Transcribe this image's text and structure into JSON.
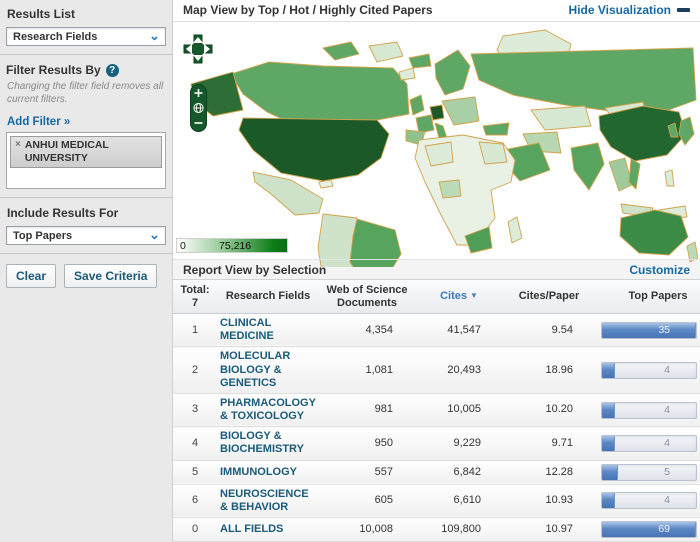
{
  "sidebar": {
    "results_list_label": "Results List",
    "results_list_value": "Research Fields",
    "filter_by_label": "Filter Results By",
    "help_icon_glyph": "?",
    "filter_note": "Changing the filter field removes all current filters.",
    "add_filter_label": "Add Filter »",
    "filter_tags": [
      {
        "remove_glyph": "×",
        "label": "ANHUI MEDICAL UNIVERSITY"
      }
    ],
    "include_results_label": "Include Results For",
    "include_results_value": "Top Papers",
    "clear_button": "Clear",
    "save_button": "Save Criteria"
  },
  "map": {
    "title": "Map View by Top / Hot / Highly Cited Papers",
    "hide_link": "Hide Visualization",
    "zoom_in_glyph": "+",
    "zoom_out_glyph": "−",
    "legend": {
      "min": "0",
      "max": "75,216",
      "min_color": "#ffffff",
      "max_color": "#0a6e14"
    },
    "border_color": "#d2a24c"
  },
  "report": {
    "title": "Report View by Selection",
    "customize_link": "Customize",
    "total_label": "Total:",
    "total_value": "7",
    "columns": {
      "field": "Research Fields",
      "docs": "Web of Science Documents",
      "cites": "Cites",
      "cites_per_paper": "Cites/Paper",
      "top_papers": "Top Papers"
    },
    "sorted_column": "Cites",
    "sort_arrow_glyph": "▼",
    "rows": [
      {
        "rank": "1",
        "field": "CLINICAL MEDICINE",
        "docs": "4,354",
        "cites": "41,547",
        "cites_per_paper": "9.54",
        "top_papers": "35",
        "bar_pct": 100
      },
      {
        "rank": "2",
        "field": "MOLECULAR BIOLOGY & GENETICS",
        "docs": "1,081",
        "cites": "20,493",
        "cites_per_paper": "18.96",
        "top_papers": "4",
        "bar_pct": 14
      },
      {
        "rank": "3",
        "field": "PHARMACOLOGY & TOXICOLOGY",
        "docs": "981",
        "cites": "10,005",
        "cites_per_paper": "10.20",
        "top_papers": "4",
        "bar_pct": 14
      },
      {
        "rank": "4",
        "field": "BIOLOGY & BIOCHEMISTRY",
        "docs": "950",
        "cites": "9,229",
        "cites_per_paper": "9.71",
        "top_papers": "4",
        "bar_pct": 14
      },
      {
        "rank": "5",
        "field": "IMMUNOLOGY",
        "docs": "557",
        "cites": "6,842",
        "cites_per_paper": "12.28",
        "top_papers": "5",
        "bar_pct": 17
      },
      {
        "rank": "6",
        "field": "NEUROSCIENCE & BEHAVIOR",
        "docs": "605",
        "cites": "6,610",
        "cites_per_paper": "10.93",
        "top_papers": "4",
        "bar_pct": 14
      },
      {
        "rank": "0",
        "field": "ALL FIELDS",
        "docs": "10,008",
        "cites": "109,800",
        "cites_per_paper": "10.97",
        "top_papers": "69",
        "bar_pct": 100
      }
    ]
  },
  "colors": {
    "link_blue": "#1468a3",
    "field_link": "#1a5a7a",
    "bar_fill": "#5a87c6",
    "map_control_green": "#15582b"
  }
}
